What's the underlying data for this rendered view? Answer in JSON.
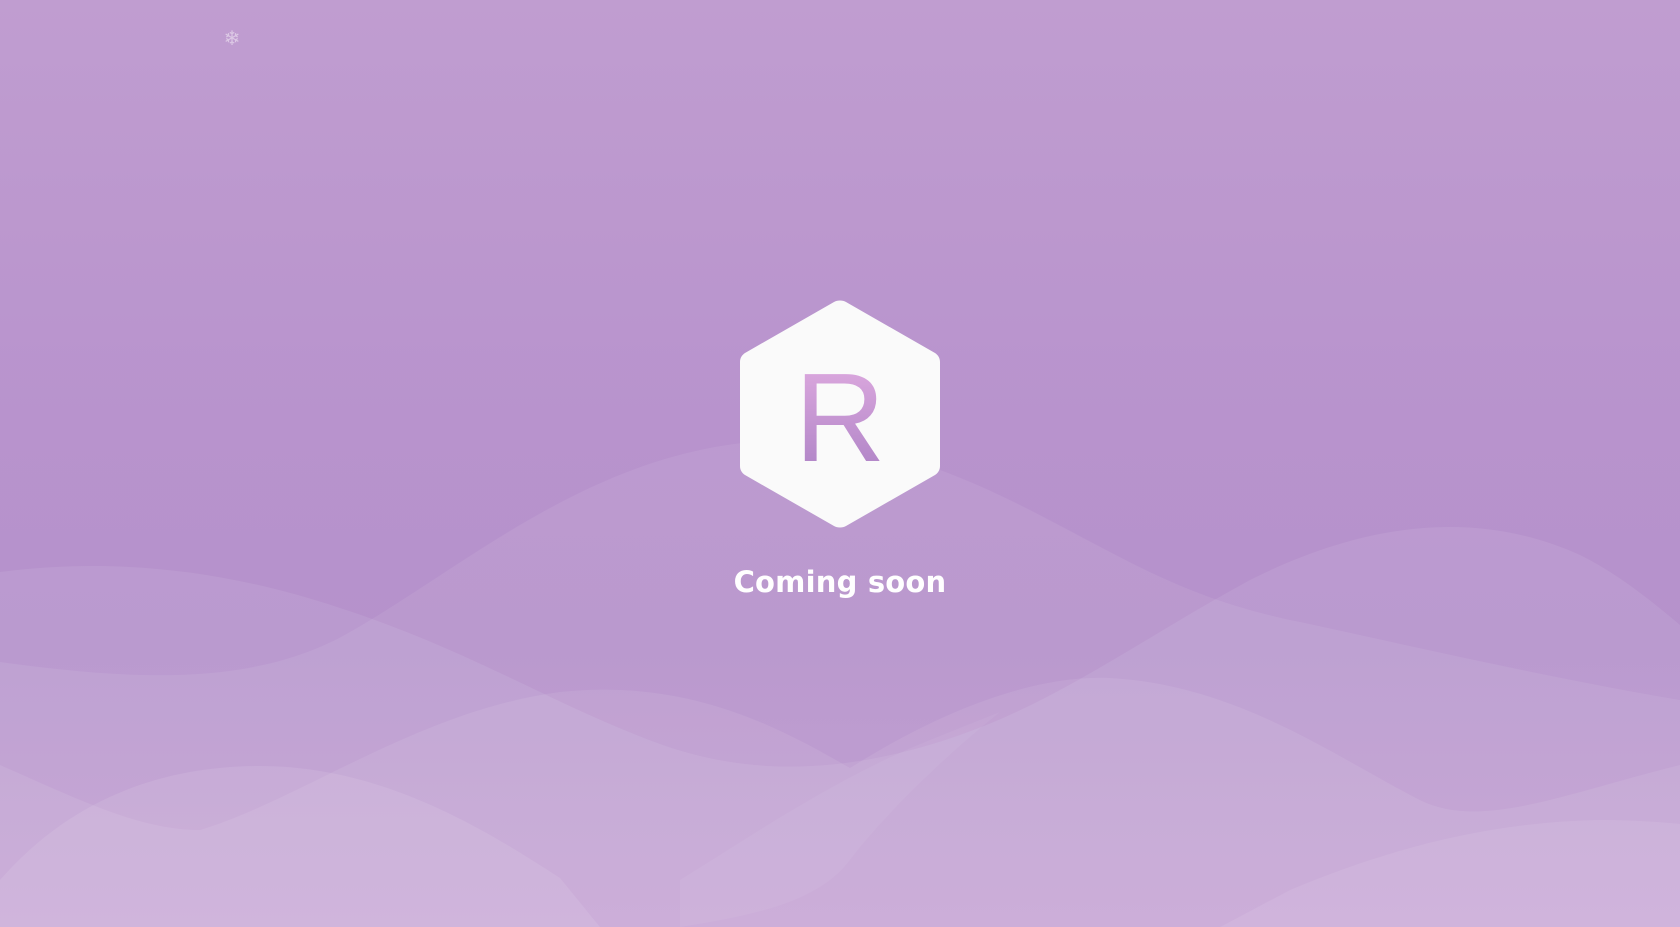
{
  "page": {
    "headline": "Coming soon",
    "logo_letter": "R",
    "decoration_icon": "snowflake-icon"
  },
  "colors": {
    "background": "#b893cd",
    "logo_hex": "#fafafa",
    "letter_gradient_top": "#e3aee2",
    "letter_gradient_bottom": "#a97fc3",
    "headline_text": "#ffffff"
  }
}
